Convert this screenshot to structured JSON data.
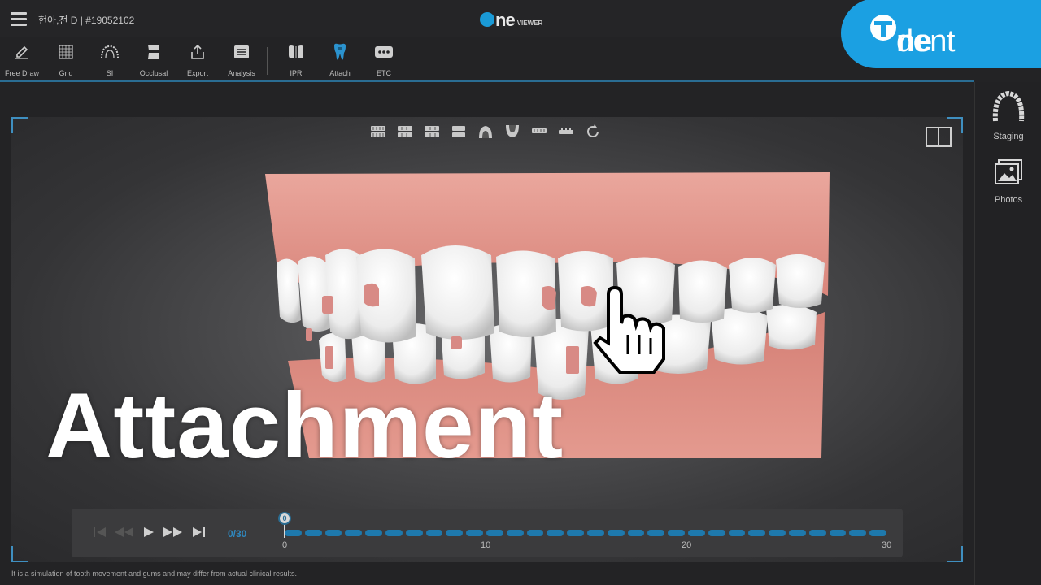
{
  "header": {
    "patient": "현아,전 D | #19052102",
    "viewer_logo": "ne",
    "viewer_logo_sub": "VIEWER"
  },
  "brand": {
    "text_light": "dent",
    "text_bold": "ne"
  },
  "toolbar": [
    {
      "label": "Free Draw",
      "icon": "pencil-icon"
    },
    {
      "label": "Grid",
      "icon": "grid-icon"
    },
    {
      "label": "SI",
      "icon": "si-arch-icon"
    },
    {
      "label": "Occlusal",
      "icon": "occlusal-icon"
    },
    {
      "label": "Export",
      "icon": "export-icon"
    },
    {
      "label": "Analysis",
      "icon": "analysis-icon"
    },
    {
      "label": "IPR",
      "icon": "ipr-icon"
    },
    {
      "label": "Attach",
      "icon": "tooth-attach-icon",
      "active": true
    },
    {
      "label": "ETC",
      "icon": "more-icon"
    }
  ],
  "right_panel": [
    {
      "label": "Staging",
      "icon": "dental-arch-icon"
    },
    {
      "label": "Photos",
      "icon": "photos-icon"
    }
  ],
  "view_icons": [
    "front-view-icon",
    "right-view-icon",
    "left-view-icon",
    "back-view-icon",
    "upper-view-icon",
    "lower-view-icon",
    "upper-jaw-icon",
    "lower-jaw-icon",
    "rotate-icon"
  ],
  "overlay_title": "Attachment",
  "timeline": {
    "counter": "0/30",
    "current": "0",
    "ticks": [
      "0",
      "10",
      "20",
      "30"
    ],
    "total_steps": 30,
    "current_step": 0
  },
  "disclaimer": "It is a simulation of tooth movement and gums and may differ from actual clinical results.",
  "colors": {
    "accent": "#1ba0e2",
    "gum": "#e9968c",
    "track": "#1e79ad"
  }
}
